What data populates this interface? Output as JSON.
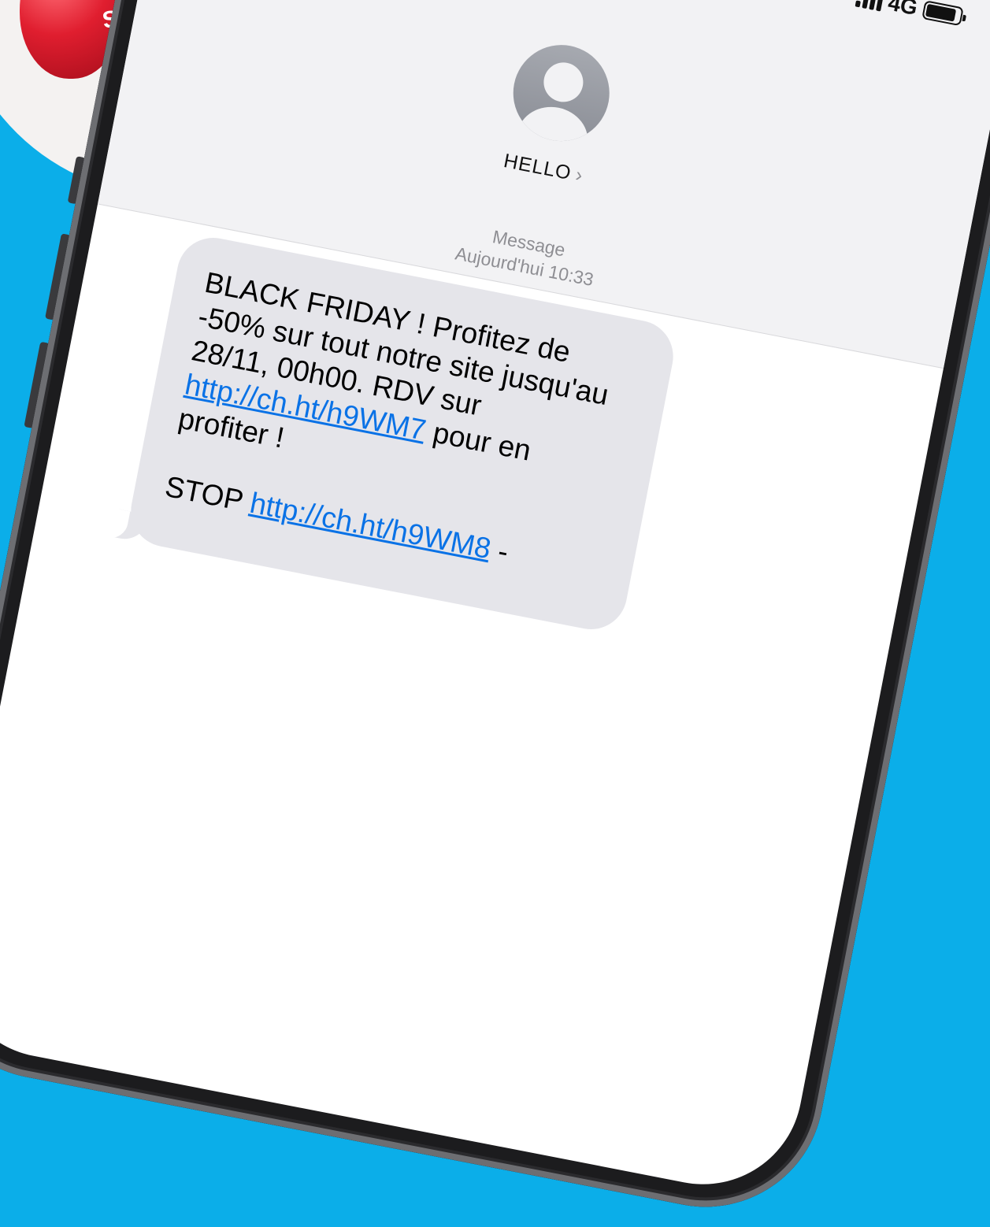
{
  "balloons": {
    "labels": [
      "SAL",
      "%"
    ]
  },
  "status_bar": {
    "network": "4G",
    "signal_bars": 4,
    "battery_level": 0.88
  },
  "contact": {
    "name": "HELLO",
    "chevron": "›",
    "avatar_icon": "person-placeholder-icon"
  },
  "thread": {
    "service": "Message",
    "timestamp": "Aujourd'hui 10:33"
  },
  "message": {
    "line1": "BLACK FRIDAY ! Profitez de -50% sur tout notre site jusqu'au 28/11, 00h00. RDV sur",
    "link1": "http://ch.ht/h9WM7",
    "line2": "pour en profiter !",
    "stop_prefix": "STOP",
    "link2": "http://ch.ht/h9WM8",
    "stop_suffix": "-"
  },
  "colors": {
    "background": "#0baee9",
    "bubble": "#e5e5ea",
    "link": "#0a72e6",
    "balloon_red": "#e01e2f"
  }
}
